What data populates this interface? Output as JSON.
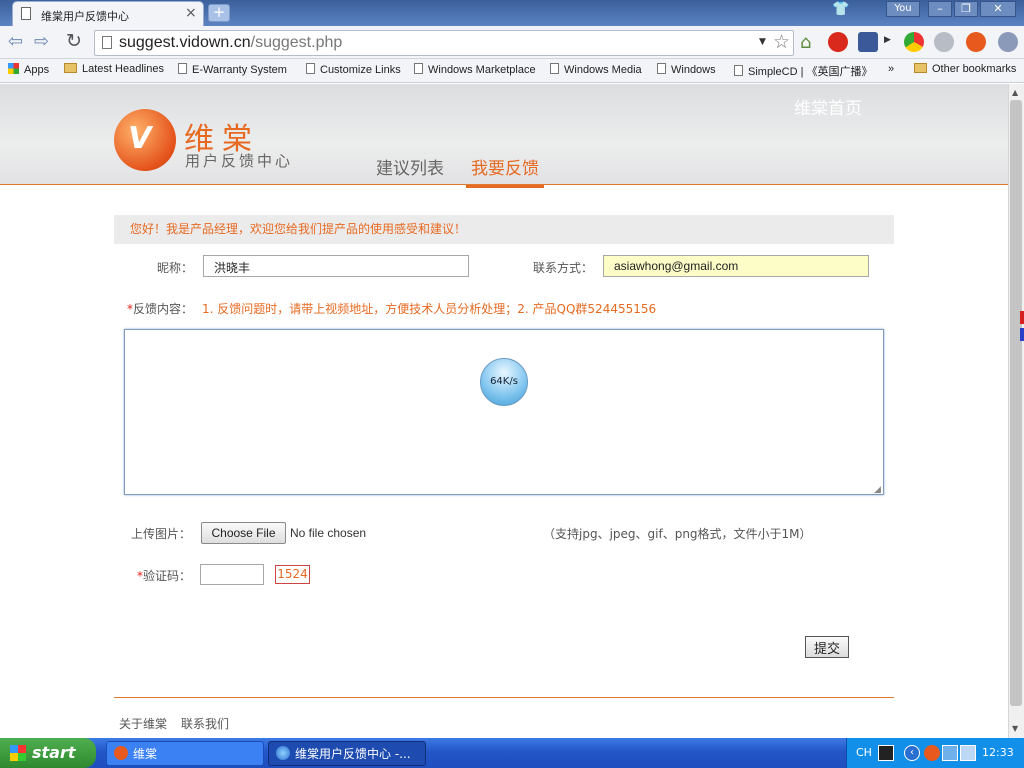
{
  "browser": {
    "tab_title": "维棠用户反馈中心",
    "user_label": "You",
    "url_host": "suggest.vidown.cn",
    "url_path": "/suggest.php",
    "bookmarks": [
      "Apps",
      "Latest Headlines",
      "E-Warranty System",
      "Customize Links",
      "Windows Marketplace",
      "Windows Media",
      "Windows",
      "SimpleCD | 《英国广播》",
      "»",
      "Other bookmarks"
    ]
  },
  "header": {
    "logo_name": "维棠",
    "logo_sub": "用户反馈中心",
    "home_link": "维棠首页",
    "nav_list": "建议列表",
    "nav_feedback": "我要反馈"
  },
  "form": {
    "welcome": "您好！我是产品经理，欢迎您给我们提产品的使用感受和建议！",
    "nick_label": "昵称：",
    "nick_value": "洪晓丰",
    "contact_label": "联系方式：",
    "contact_value": "asiawhong@gmail.com",
    "content_label": "反馈内容：",
    "required_mark": "*",
    "tips": "1. 反馈问题时，请带上视频地址，方便技术人员分析处理；2. 产品QQ群524455156",
    "speed_widget": "64K/s",
    "upload_label": "上传图片：",
    "choose_file": "Choose File",
    "no_file": "No file chosen",
    "format_note": "（支持jpg、jpeg、gif、png格式，文件小于1M）",
    "captcha_label": "验证码：",
    "captcha_code": "1524",
    "submit": "提交"
  },
  "footer": {
    "about": "关于维棠",
    "contact": "联系我们"
  },
  "taskbar": {
    "start": "start",
    "task1": "维棠",
    "task2": "维棠用户反馈中心 -...",
    "lang": "CH",
    "clock": "12:33"
  },
  "colors": {
    "accent": "#e76a22",
    "taskbar": "#2456c8"
  }
}
